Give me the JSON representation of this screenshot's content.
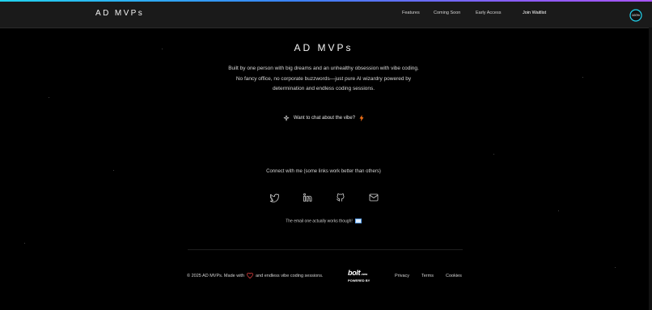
{
  "colors": {
    "background": "#000000",
    "navbar": "#1a1a1a",
    "accent_cyan": "#22d3ee",
    "accent_purple": "#a855f7",
    "heart": "#ef4444",
    "bolt_orange": "#f97316"
  },
  "header": {
    "brand": "AD MVPs",
    "nav": [
      {
        "label": "Features"
      },
      {
        "label": "Coming Soon"
      },
      {
        "label": "Early Access"
      },
      {
        "label": "Join Waitlist"
      }
    ],
    "progress": {
      "label": "100%",
      "value": 1.0
    }
  },
  "hero": {
    "title": "AD MVPs",
    "description": "Built by one person with big dreams and an unhealthy obsession with vibe coding. No fancy office, no corporate buzzwords—just pure AI wizardry powered by determination and endless coding sessions.",
    "chat_prompt": "Want to chat about the vibe?",
    "chat_icon": "sparkles-icon",
    "chat_emoji": "lightning-icon"
  },
  "connect": {
    "heading": "Connect with me (some links work better than others)",
    "socials": [
      {
        "icon": "twitter-icon"
      },
      {
        "icon": "linkedin-icon"
      },
      {
        "icon": "github-icon"
      },
      {
        "icon": "mail-icon"
      }
    ],
    "email_note": "The email one actually works though!",
    "email_emoji": "envelope-emoji"
  },
  "footer": {
    "copyright_prefix": "© 2025 AD MVPs. Made with",
    "copyright_suffix": "and endless vibe coding sessions.",
    "badge": {
      "logo": "bolt",
      "logo_suffix": ".new",
      "tagline": "POWERED BY"
    },
    "links": [
      {
        "label": "Privacy"
      },
      {
        "label": "Terms"
      },
      {
        "label": "Cookies"
      }
    ]
  }
}
